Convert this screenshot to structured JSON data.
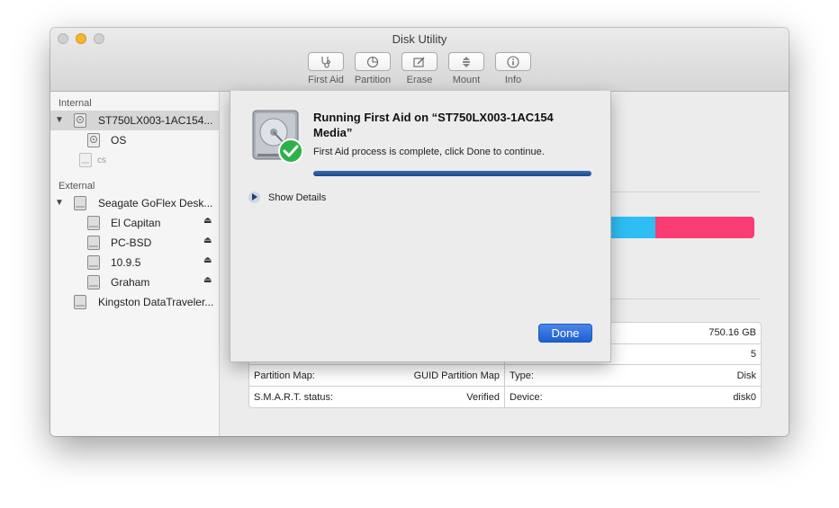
{
  "window": {
    "title": "Disk Utility"
  },
  "toolbar": {
    "buttons": [
      {
        "label": "First Aid",
        "icon": "stethoscope-icon"
      },
      {
        "label": "Partition",
        "icon": "pie-chart-icon"
      },
      {
        "label": "Erase",
        "icon": "erase-icon"
      },
      {
        "label": "Mount",
        "icon": "mount-icon"
      },
      {
        "label": "Info",
        "icon": "info-icon"
      }
    ]
  },
  "sidebar": {
    "internal_label": "Internal",
    "external_label": "External",
    "internal_items": [
      {
        "label": "ST750LX003-1AC154...",
        "selected": true
      },
      {
        "label": "OS"
      },
      {
        "label": "cs"
      }
    ],
    "external_items": [
      {
        "label": "Seagate GoFlex Desk..."
      },
      {
        "label": "El Capitan"
      },
      {
        "label": "PC-BSD"
      },
      {
        "label": "10.9.5"
      },
      {
        "label": "Graham"
      },
      {
        "label": "Kingston DataTraveler..."
      }
    ]
  },
  "usage_colors": {
    "free": "#2ebef4",
    "used": "#fa3c74"
  },
  "info": {
    "capacity_value": "750.16 GB",
    "child_count_value": "5",
    "partition_map_label": "Partition Map:",
    "partition_map_value": "GUID Partition Map",
    "smart_label": "S.M.A.R.T. status:",
    "smart_value": "Verified",
    "type_label": "Type:",
    "type_value": "Disk",
    "device_label": "Device:",
    "device_value": "disk0"
  },
  "sheet": {
    "title": "Running First Aid on “ST750LX003-1AC154 Media”",
    "message": "First Aid process is complete, click Done to continue.",
    "progress": 1.0,
    "show_details_label": "Show Details",
    "done_label": "Done",
    "accent_color": "#1d5fd1"
  }
}
